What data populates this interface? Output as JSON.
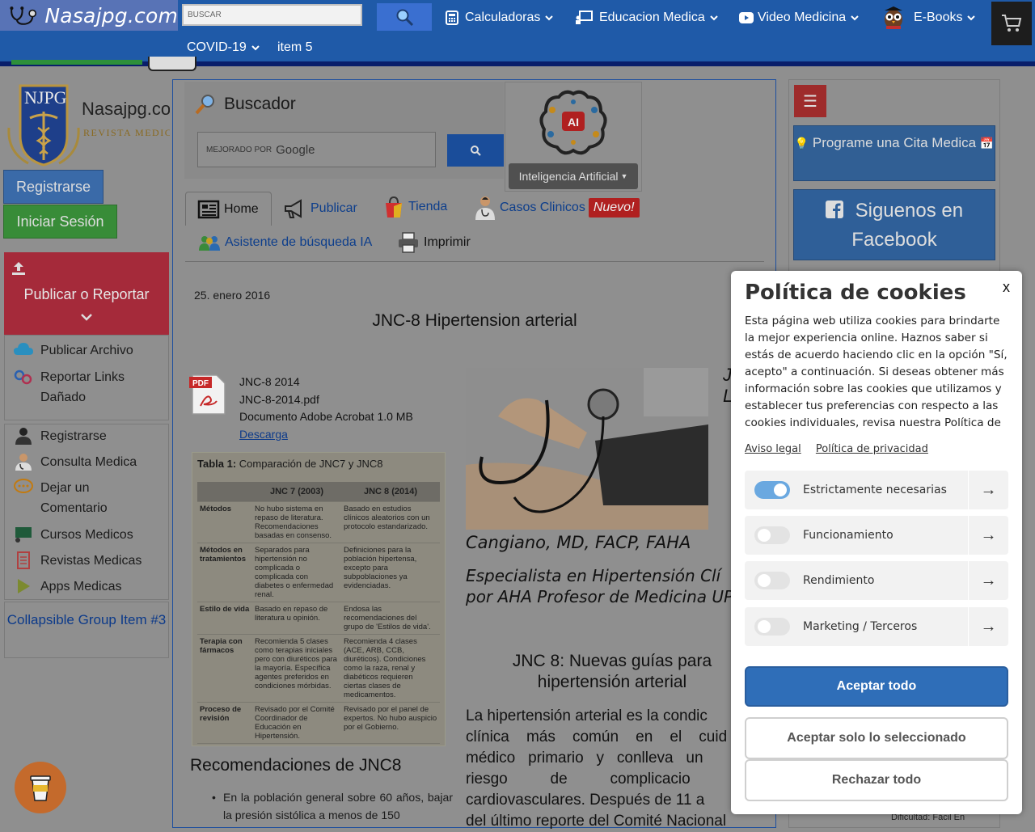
{
  "topnav": {
    "logo_text": "Nasajpg.com",
    "search_placeholder": "BUSCAR",
    "items": [
      {
        "label": "Calculadoras"
      },
      {
        "label": "Educacion Medica"
      },
      {
        "label": "Video Medicina"
      },
      {
        "label": "E-Books"
      },
      {
        "label": "COVID-19"
      },
      {
        "label": "item 5"
      }
    ]
  },
  "left": {
    "logo_monogram": "NJPG",
    "logo_brand": "Nasajpg.com",
    "logo_sub": "REVISTA MEDICA",
    "register_label": "Registrarse",
    "login_label": "Iniciar Sesión",
    "publish_title": "Publicar o Reportar",
    "publish_links": [
      {
        "label": "Publicar Archivo"
      },
      {
        "label": "Reportar Links Dañado"
      }
    ],
    "links": [
      {
        "label": "Registrarse"
      },
      {
        "label": "Consulta Medica"
      },
      {
        "label": "Dejar un Comentario"
      },
      {
        "label": "Cursos Medicos"
      },
      {
        "label": "Revistas Medicas"
      },
      {
        "label": "Apps Medicas"
      }
    ],
    "collapsible_label": "Collapsible Group Item #3"
  },
  "main": {
    "buscador_title": "Buscador",
    "gsearch_prefix": "MEJORADO POR",
    "gsearch_brand": "Google",
    "ai_label": "Inteligencia Artificial",
    "ai_badge": "AI",
    "tabs": [
      {
        "label": "Home"
      },
      {
        "label": "Publicar"
      },
      {
        "label": "Tienda"
      },
      {
        "label": "Casos Clinicos"
      },
      {
        "label": "Asistente de búsqueda IA"
      },
      {
        "label": "Imprimir"
      }
    ],
    "new_badge": "Nuevo!",
    "date": "25. enero 2016",
    "title": "JNC-8 Hipertension arterial",
    "pdf": {
      "name": "JNC-8 2014",
      "file": "JNC-8-2014.pdf",
      "info": "Documento Adobe Acrobat 1.0 MB",
      "download": "Descarga",
      "icon_label": "PDF"
    },
    "table": {
      "caption_bold": "Tabla 1:",
      "caption": " Comparación de JNC7 y JNC8",
      "headers": [
        "",
        "JNC 7 (2003)",
        "JNC 8 (2014)"
      ],
      "rows": [
        [
          "Métodos",
          "No hubo sistema en repaso de literatura. Recomendaciones basadas en consenso.",
          "Basado en estudios clínicos aleatorios con un protocolo estandarizado."
        ],
        [
          "Métodos en tratamientos",
          "Separados para hipertensión no complicada o complicada con diabetes o enfermedad renal.",
          "Definiciones para la población hipertensa, excepto para subpoblaciones ya evidenciadas."
        ],
        [
          "Estilo de vida",
          "Basado en repaso de literatura u opinión.",
          "Endosa las recomendaciones del grupo de 'Estilos de vida'."
        ],
        [
          "Terapia con fármacos",
          "Recomienda 5 clases como terapias iniciales pero con diuréticos para la mayoría. Específica agentes preferidos en condiciones mórbidas.",
          "Recomienda 4 clases (ACE, ARB, CCB, diuréticos). Condiciones como la raza, renal y diabéticos requieren ciertas clases de medicamentos."
        ],
        [
          "Proceso de revisión",
          "Revisado por el Comité Coordinador de Educación en Hipertensión.",
          "Revisado por el panel de expertos. No hubo auspicio por el Gobierno."
        ]
      ]
    },
    "recs_title": "Recomendaciones de JNC8",
    "recs_item": "En la población general sobre 60 años, bajar la presión sistólica a menos de 150",
    "doctor_name": "Cangiano, MD, FACP, FAHA",
    "doctor_spec_1": "Especialista en Hipertensión Clí",
    "doctor_spec_2": "por AHA Profesor de Medicina UP",
    "doctor_side_1": "J",
    "doctor_side_2": "L",
    "sec2_title": "JNC 8: Nuevas guías para hipertensión arterial",
    "sec2_body_lines": [
      "La hipertensión arterial es la condic",
      "clínica    más    común    en    el    cuid",
      "médico   primario   y   conlleva   un",
      "riesgo          de          complicacio",
      "cardiovasculares. Después de 11 a",
      "del último reporte del Comité Nacional"
    ]
  },
  "right": {
    "menu_icon": "☰",
    "cita_label": "Programe una Cita Medica",
    "facebook_label": "Siguenos en Facebook",
    "dificultad": "Dificultad: Fácil En"
  },
  "cookie": {
    "title": "Política de cookies",
    "close": "x",
    "body": "Esta página web utiliza cookies para brindarte la mejor experiencia online. Haznos saber si estás de acuerdo haciendo clic en la opción \"Sí, acepto\" a continuación. Si deseas obtener más información sobre las cookies que utilizamos y establecer tus preferencias con respecto a las cookies individuales, revisa nuestra Política de",
    "link_legal": "Aviso legal",
    "link_privacy": "Política de privacidad",
    "prefs": [
      {
        "label": "Estrictamente necesarias",
        "on": true
      },
      {
        "label": "Funcionamiento",
        "on": false
      },
      {
        "label": "Rendimiento",
        "on": false
      },
      {
        "label": "Marketing / Terceros",
        "on": false
      }
    ],
    "accept_all": "Aceptar todo",
    "accept_selected": "Aceptar solo lo seleccionado",
    "reject_all": "Rechazar todo"
  },
  "colors": {
    "nav_blue": "#1f5aa8",
    "accent_red": "#a52a3a",
    "cookie_primary": "#2f6eb8"
  }
}
